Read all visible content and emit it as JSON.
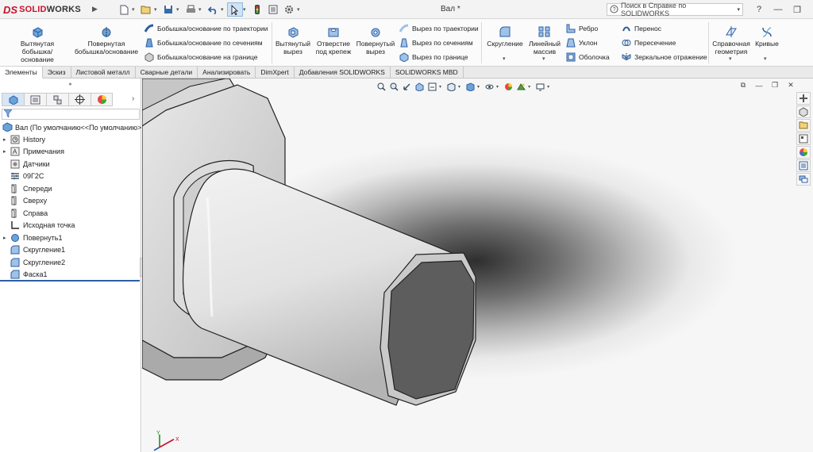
{
  "app": {
    "logo_ds": "DS",
    "logo_solid": "SOLID",
    "logo_works": "WORKS",
    "doc_title": "Вал *",
    "help_placeholder": "Поиск в Справке по SOLIDWORKS"
  },
  "ribbon": {
    "extrude_boss": "Вытянутая бобышка/основание",
    "revolve_boss": "Повернутая бобышка/основание",
    "sweep_boss": "Бобышка/основание по траектории",
    "loft_boss": "Бобышка/основание по сечениям",
    "boundary_boss": "Бобышка/основание на границе",
    "extrude_cut": "Вытянутый вырез",
    "hole_wizard": "Отверстие под крепеж",
    "revolve_cut": "Повернутый вырез",
    "sweep_cut": "Вырез по траектории",
    "loft_cut": "Вырез по сечениям",
    "boundary_cut": "Вырез по границе",
    "fillet": "Скругление",
    "linear_pattern": "Линейный массив",
    "rib": "Ребро",
    "draft": "Уклон",
    "shell": "Оболочка",
    "wrap": "Перенос",
    "intersect": "Пересечение",
    "mirror": "Зеркальное отражение",
    "ref_geometry": "Справочная геометрия",
    "curves": "Кривые"
  },
  "tabs": [
    {
      "label": "Элементы",
      "active": true
    },
    {
      "label": "Эскиз"
    },
    {
      "label": "Листовой металл"
    },
    {
      "label": "Сварные детали"
    },
    {
      "label": "Анализировать"
    },
    {
      "label": "DimXpert"
    },
    {
      "label": "Добавления SOLIDWORKS"
    },
    {
      "label": "SOLIDWORKS MBD"
    }
  ],
  "tree": {
    "root": "Вал  (По умолчанию<<По умолчанию>",
    "items": [
      {
        "label": "History",
        "expandable": true
      },
      {
        "label": "Примечания",
        "expandable": true
      },
      {
        "label": "Датчики"
      },
      {
        "label": "09Г2С"
      },
      {
        "label": "Спереди"
      },
      {
        "label": "Сверху"
      },
      {
        "label": "Справа"
      },
      {
        "label": "Исходная точка"
      },
      {
        "label": "Повернуть1",
        "expandable": true
      },
      {
        "label": "Скругление1"
      },
      {
        "label": "Скругление2"
      },
      {
        "label": "Фаска1"
      }
    ]
  },
  "triad": {
    "y": "Y",
    "x": "X"
  },
  "colors": {
    "brand": "#c8102e",
    "accent": "#2d5ea3",
    "selection": "#cfe3f7"
  }
}
